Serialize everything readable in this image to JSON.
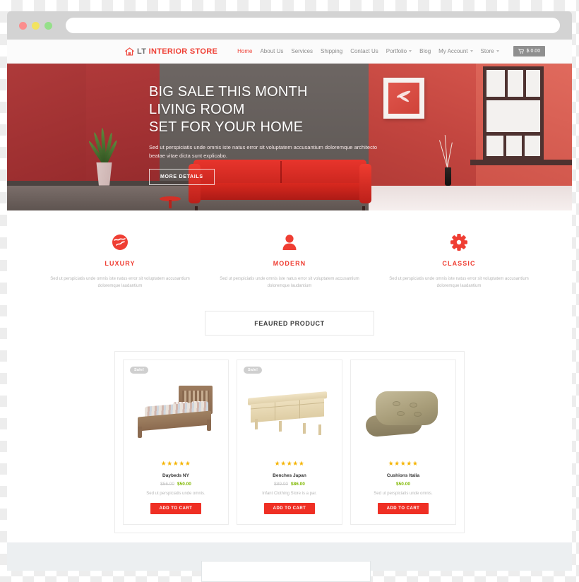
{
  "browser": {
    "traffic_lights": [
      "close-red",
      "minimize-yellow",
      "maximize-green"
    ],
    "url_value": "",
    "url_placeholder": ""
  },
  "header": {
    "logo_icon": "home-icon",
    "logo_text_primary": "LT",
    "logo_text_secondary": "INTERIOR STORE",
    "nav": [
      {
        "label": "Home",
        "active": true,
        "has_caret": false
      },
      {
        "label": "About Us",
        "active": false,
        "has_caret": false
      },
      {
        "label": "Services",
        "active": false,
        "has_caret": false
      },
      {
        "label": "Shipping",
        "active": false,
        "has_caret": false
      },
      {
        "label": "Contact Us",
        "active": false,
        "has_caret": false
      },
      {
        "label": "Portfolio",
        "active": false,
        "has_caret": true
      },
      {
        "label": "Blog",
        "active": false,
        "has_caret": false
      },
      {
        "label": "My Account",
        "active": false,
        "has_caret": true
      },
      {
        "label": "Store",
        "active": false,
        "has_caret": true
      }
    ],
    "cart": {
      "icon": "shopping-cart-icon",
      "amount": "$ 0.00"
    }
  },
  "hero": {
    "title_line1": "BIG SALE THIS MONTH",
    "title_line2": "LIVING ROOM",
    "title_line3": "SET FOR YOUR HOME",
    "subtitle": "Sed ut perspiciatis unde omnis iste natus error sit voluptatem accusantium doloremque architecto beatae vitae dicta sunt explicabo.",
    "button_label": "MORE DETAILS"
  },
  "features": [
    {
      "icon": "globe-icon",
      "title": "LUXURY",
      "desc": "Sed ut perspiciatis unde omnis iste natus error sit voluptatem accusantium doloremque laudantium"
    },
    {
      "icon": "user-icon",
      "title": "MODERN",
      "desc": "Sed ut perspiciatis unde omnis iste natus error sit voluptatem accusantium doloremque laudantium"
    },
    {
      "icon": "gear-icon",
      "title": "CLASSIC",
      "desc": "Sed ut perspiciatis unde omnis iste natus error sit voluptatem accusantium doloremque laudantium"
    }
  ],
  "section": {
    "featured_heading": "FEAURED PRODUCT"
  },
  "products": [
    {
      "badge": "Sale!",
      "image": "wooden-bed-frame",
      "stars": "★★★★★",
      "name": "Daybeds NY",
      "price_old": "$56.00",
      "price_new": "$50.00",
      "desc": "Sed ut perspiciatis unde omnis.",
      "button_label": "ADD TO CART"
    },
    {
      "badge": "Sale!",
      "image": "pine-sideboard",
      "stars": "★★★★★",
      "name": "Benches Japan",
      "price_old": "$89.00",
      "price_new": "$86.00",
      "desc": "Infant Clothing Store is a par.",
      "button_label": "ADD TO CART"
    },
    {
      "badge": "",
      "image": "tan-cushions",
      "stars": "★★★★★",
      "name": "Cushions Italia",
      "price_old": "",
      "price_new": "$50.00",
      "desc": "Sed ut perspiciatis unde omnis.",
      "button_label": "ADD TO CART"
    }
  ],
  "colors": {
    "brand_red": "#ef4136",
    "button_red": "#ef2f24",
    "price_green": "#7fb800",
    "star_gold": "#f5b400",
    "nav_gray": "#8c8c8c",
    "cart_gray": "#8f8f8f",
    "footer_band": "#eceff1"
  }
}
